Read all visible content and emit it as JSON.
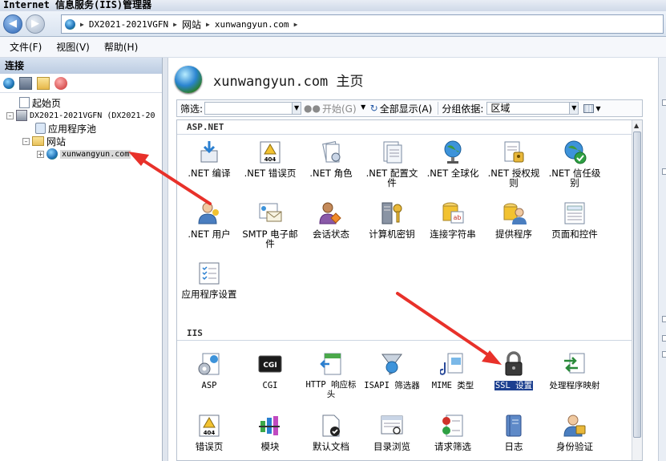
{
  "window": {
    "title": "Internet 信息服务(IIS)管理器"
  },
  "address": {
    "crumbs": [
      "DX2021-2021VGFN",
      "网站",
      "xunwangyun.com"
    ]
  },
  "menu": {
    "items": [
      "文件(F)",
      "视图(V)",
      "帮助(H)"
    ]
  },
  "connections": {
    "title": "连接",
    "tree": [
      {
        "label": "起始页"
      },
      {
        "label": "DX2021-2021VGFN (DX2021-20"
      },
      {
        "label": "应用程序池"
      },
      {
        "label": "网站"
      },
      {
        "label": "xunwangyun.com"
      }
    ]
  },
  "main": {
    "title": "xunwangyun.com 主页",
    "filter": {
      "label": "筛选:",
      "start": "开始(G)",
      "show_all": "全部显示(A)",
      "group_by": "分组依据:",
      "group_value": "区域"
    },
    "groups": [
      {
        "name": "ASP.NET",
        "features": [
          ".NET 编译",
          ".NET 错误页",
          ".NET 角色",
          ".NET 配置文件",
          ".NET 全球化",
          ".NET 授权规则",
          ".NET 信任级别",
          ".NET 用户",
          "SMTP 电子邮件",
          "会话状态",
          "计算机密钥",
          "连接字符串",
          "提供程序",
          "页面和控件",
          "应用程序设置"
        ]
      },
      {
        "name": "IIS",
        "features": [
          "ASP",
          "CGI",
          "HTTP 响应标头",
          "ISAPI 筛选器",
          "MIME 类型",
          "SSL 设置",
          "处理程序映射",
          "错误页",
          "模块",
          "默认文档",
          "目录浏览",
          "请求筛选",
          "日志",
          "身份验证"
        ]
      }
    ],
    "selected_feature": "SSL 设置"
  },
  "colors": {
    "accent": "#1c3f8f",
    "arrow": "#e8312a",
    "header": "#bccce2"
  }
}
